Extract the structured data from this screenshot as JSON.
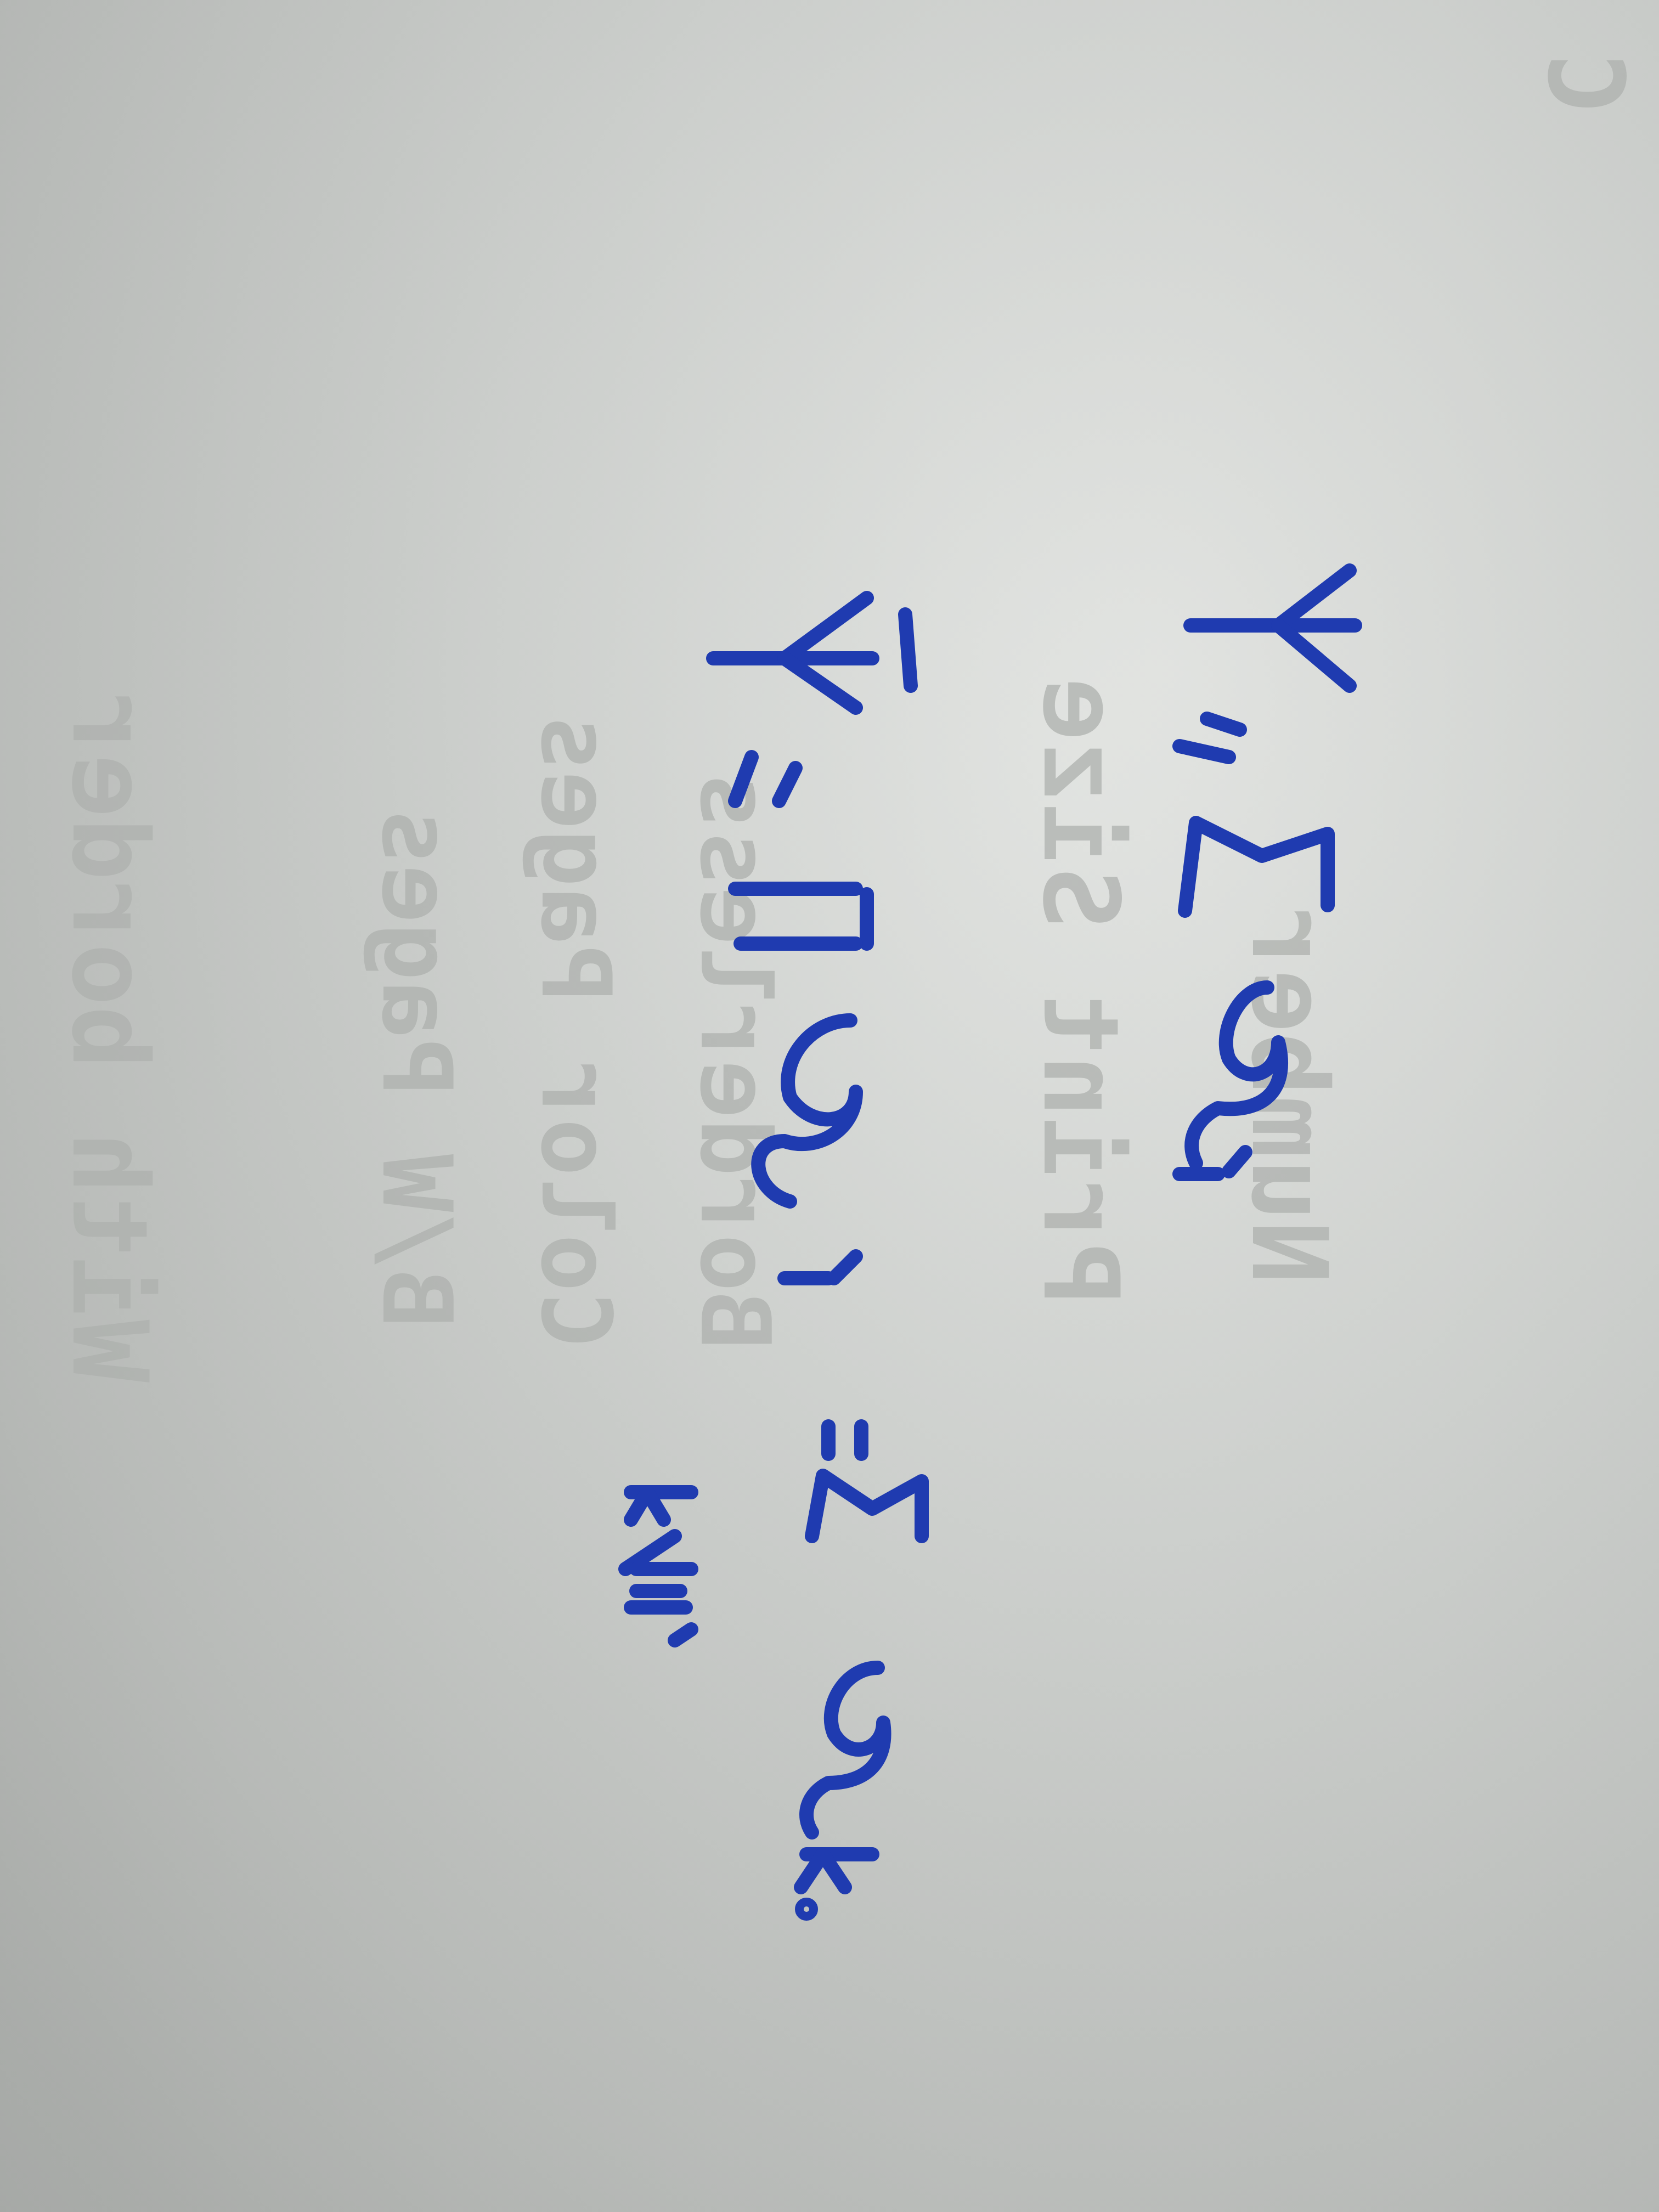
{
  "photo": {
    "description_type": "handwritten note on paper (rotated)",
    "ink_color": "#1f3bb0",
    "paper_color": "#d3d6d3"
  },
  "handwriting": {
    "line1": "Y = Σ mᵢ",
    "line2": "Ȳ = Π Mᵢ = Σ mₖ .",
    "line2_subscript": "k≠i"
  },
  "bleed_through": {
    "text1": "With border",
    "text2": "B/W Pages",
    "text3": "Color Pages",
    "text4": "Borderless",
    "text5": "Number",
    "text6": "Print Size",
    "text7": "C"
  }
}
